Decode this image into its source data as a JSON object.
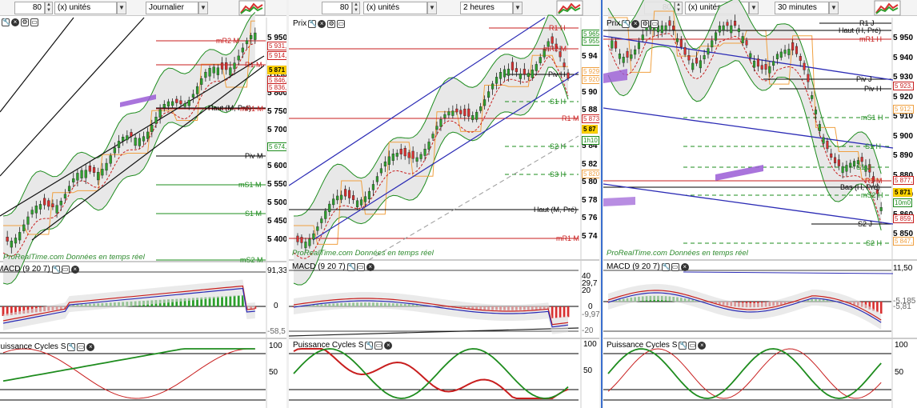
{
  "colors": {
    "bull": "#2ea02e",
    "bear": "#d83030",
    "orange": "#f0a040",
    "blue": "#2b2bb5",
    "green": "#1e8c1e",
    "red": "#c81e1e",
    "purple": "#9a5cd6"
  },
  "panes": [
    {
      "toolbar": {
        "units": "80",
        "scale": "(x) unités",
        "period": "Journalier",
        "logo_icon": "chart-logo-icon"
      },
      "price": {
        "title": "Prix",
        "levels": [
          {
            "label": "mR2 M",
            "color": "red"
          },
          {
            "label": "R1 M",
            "color": "red"
          },
          {
            "label": "Haut (M, Pré)",
            "color": "black"
          },
          {
            "label": "mR1 M",
            "color": "red"
          },
          {
            "label": "Piv M",
            "color": "black"
          },
          {
            "label": "mS1 M",
            "color": "green"
          },
          {
            "label": "S1 M",
            "color": "green"
          },
          {
            "label": "mS2 M",
            "color": "green"
          }
        ],
        "axis": [
          "5 950",
          "5 900",
          "5 850",
          "5 800",
          "5 750",
          "5 700",
          "5 650",
          "5 600",
          "5 550",
          "5 500",
          "5 450",
          "5 400"
        ],
        "tags": [
          "5 931,",
          "5 914,",
          "5 871",
          "5 846,",
          "5 836,",
          "5 674,"
        ],
        "watermark": "ProRealTime.com  Données en temps réel"
      },
      "macd": {
        "title": "MACD (9 20 7)",
        "axis": [
          "91,33",
          "0",
          "-58,5"
        ]
      },
      "cycles": {
        "title": "Puissance Cycles S",
        "axis": [
          "100",
          "50"
        ]
      }
    },
    {
      "toolbar": {
        "units": "80",
        "scale": "(x) unités",
        "period": "2 heures",
        "logo_icon": "chart-logo-icon"
      },
      "price": {
        "title": "Prix",
        "levels": [
          {
            "label": "R1 H",
            "color": "red"
          },
          {
            "label": "mR2 M",
            "color": "red"
          },
          {
            "label": "Piv H",
            "color": "black"
          },
          {
            "label": "S1 H",
            "color": "green"
          },
          {
            "label": "R1 M",
            "color": "red"
          },
          {
            "label": "S2 H",
            "color": "green"
          },
          {
            "label": "S3 H",
            "color": "green"
          },
          {
            "label": "Haut (M, Pré)",
            "color": "black"
          },
          {
            "label": "mR1 M",
            "color": "red"
          }
        ],
        "axis": [
          "5 96",
          "5 94",
          "5 92",
          "5 90",
          "5 88",
          "5 86",
          "5 84",
          "5 82",
          "5 80",
          "5 78",
          "5 76",
          "5 74"
        ],
        "tags": [
          "5 965",
          "5 955",
          "5 929",
          "5 920",
          "5 873",
          "5 87",
          "1h10",
          "5 820"
        ],
        "watermark": "ProRealTime.com  Données en temps réel"
      },
      "macd": {
        "title": "MACD (9 20 7)",
        "axis": [
          "40",
          "29,7",
          "20",
          "0",
          "-9,97",
          "-20"
        ]
      },
      "cycles": {
        "title": "Puissance Cycles S",
        "axis": [
          "100",
          "50"
        ]
      }
    },
    {
      "toolbar": {
        "units": "80",
        "scale": "(x) unités",
        "period": "30 minutes",
        "logo_icon": "chart-logo-icon"
      },
      "price": {
        "title": "Prix",
        "levels": [
          {
            "label": "R1 J",
            "color": "black"
          },
          {
            "label": "Haut (H, Pré)",
            "color": "black"
          },
          {
            "label": "mR1 H",
            "color": "red"
          },
          {
            "label": "Piv J",
            "color": "black"
          },
          {
            "label": "Piv H",
            "color": "black"
          },
          {
            "label": "mS1 H",
            "color": "green"
          },
          {
            "label": "S1 H",
            "color": "green"
          },
          {
            "label": "S1 J",
            "color": "green"
          },
          {
            "label": "R1 M",
            "color": "red"
          },
          {
            "label": "Bas (H, Pré)",
            "color": "black"
          },
          {
            "label": "mS2 H",
            "color": "green"
          },
          {
            "label": "S2 J",
            "color": "black"
          },
          {
            "label": "S2 H",
            "color": "green"
          }
        ],
        "axis": [
          "5 950",
          "5 940",
          "5 930",
          "5 920",
          "5 910",
          "5 900",
          "5 890",
          "5 880",
          "5 870",
          "5 860",
          "5 850"
        ],
        "tags": [
          "5 923,",
          "5 912,",
          "5 877,",
          "5 871",
          "10m0",
          "5 859,",
          "5 847,"
        ],
        "watermark": "ProRealTime.com  Données en temps réel"
      },
      "macd": {
        "title": "MACD (9 20 7)",
        "axis": [
          "11,50",
          "-5,185",
          "-5,81"
        ]
      },
      "cycles": {
        "title": "Puissance Cycles S",
        "axis": [
          "100",
          "50"
        ]
      }
    }
  ]
}
